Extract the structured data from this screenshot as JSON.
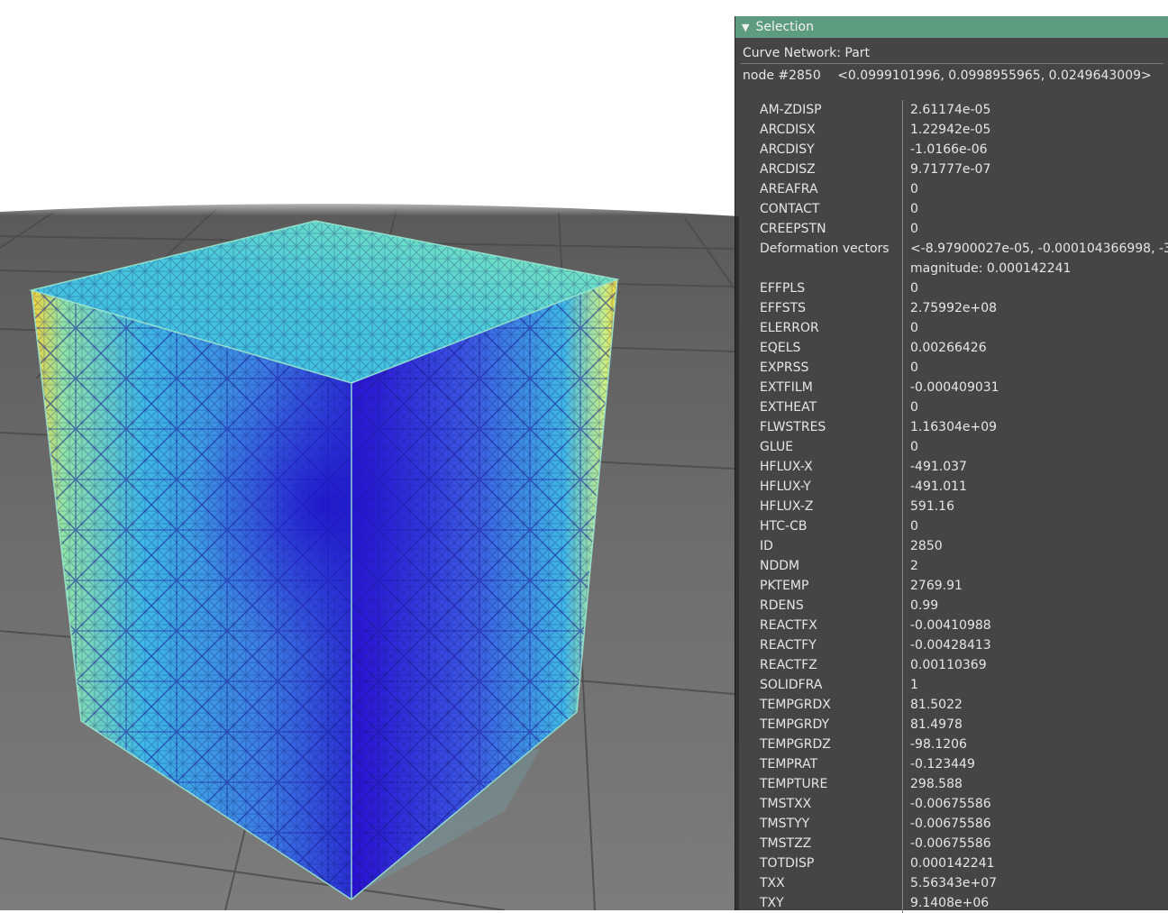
{
  "viewport": {
    "object": "lattice-cube",
    "colormap": [
      "#2a0fd6",
      "#3b58e3",
      "#3fb8e6",
      "#5ee3d2",
      "#c8f08a",
      "#f2d23a"
    ],
    "background": "#ffffff",
    "ground": "#6a6a6a"
  },
  "panel": {
    "header": "Selection",
    "header_color": "#5e9c80",
    "structure": "Curve Network: Part",
    "node": {
      "label": "node #2850",
      "coords": "<0.0999101996, 0.0998955965, 0.0249643009>"
    },
    "quantities": [
      {
        "name": "AM-ZDISP",
        "value": "2.61174e-05"
      },
      {
        "name": "ARCDISX",
        "value": "1.22942e-05"
      },
      {
        "name": "ARCDISY",
        "value": "-1.0166e-06"
      },
      {
        "name": "ARCDISZ",
        "value": "9.71777e-07"
      },
      {
        "name": "AREAFRA",
        "value": "0"
      },
      {
        "name": "CONTACT",
        "value": "0"
      },
      {
        "name": "CREEPSTN",
        "value": "0"
      },
      {
        "name": "Deformation vectors",
        "value": "<-8.97900027e-05, -0.000104366998, -3.",
        "value2": "magnitude: 0.000142241"
      },
      {
        "name": "EFFPLS",
        "value": "0"
      },
      {
        "name": "EFFSTS",
        "value": "2.75992e+08"
      },
      {
        "name": "ELERROR",
        "value": "0"
      },
      {
        "name": "EQELS",
        "value": "0.00266426"
      },
      {
        "name": "EXPRSS",
        "value": "0"
      },
      {
        "name": "EXTFILM",
        "value": "-0.000409031"
      },
      {
        "name": "EXTHEAT",
        "value": "0"
      },
      {
        "name": "FLWSTRES",
        "value": "1.16304e+09"
      },
      {
        "name": "GLUE",
        "value": "0"
      },
      {
        "name": "HFLUX-X",
        "value": "-491.037"
      },
      {
        "name": "HFLUX-Y",
        "value": "-491.011"
      },
      {
        "name": "HFLUX-Z",
        "value": "591.16"
      },
      {
        "name": "HTC-CB",
        "value": "0"
      },
      {
        "name": "ID",
        "value": "2850"
      },
      {
        "name": "NDDM",
        "value": "2"
      },
      {
        "name": "PKTEMP",
        "value": "2769.91"
      },
      {
        "name": "RDENS",
        "value": "0.99"
      },
      {
        "name": "REACTFX",
        "value": "-0.00410988"
      },
      {
        "name": "REACTFY",
        "value": "-0.00428413"
      },
      {
        "name": "REACTFZ",
        "value": "0.00110369"
      },
      {
        "name": "SOLIDFRA",
        "value": "1"
      },
      {
        "name": "TEMPGRDX",
        "value": "81.5022"
      },
      {
        "name": "TEMPGRDY",
        "value": "81.4978"
      },
      {
        "name": "TEMPGRDZ",
        "value": "-98.1206"
      },
      {
        "name": "TEMPRAT",
        "value": "-0.123449"
      },
      {
        "name": "TEMPTURE",
        "value": "298.588"
      },
      {
        "name": "TMSTXX",
        "value": "-0.00675586"
      },
      {
        "name": "TMSTYY",
        "value": "-0.00675586"
      },
      {
        "name": "TMSTZZ",
        "value": "-0.00675586"
      },
      {
        "name": "TOTDISP",
        "value": "0.000142241"
      },
      {
        "name": "TXX",
        "value": "5.56343e+07"
      },
      {
        "name": "TXY",
        "value": "9.1408e+06"
      }
    ]
  }
}
